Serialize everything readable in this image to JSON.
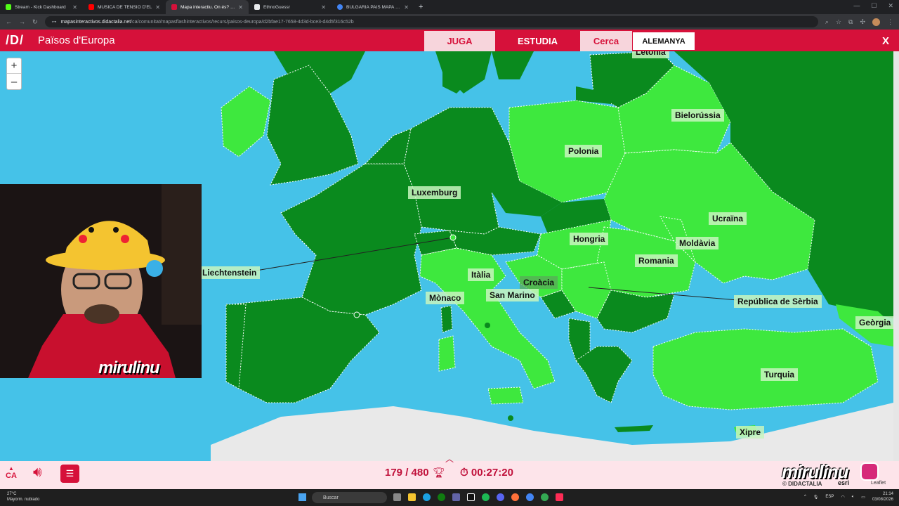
{
  "browser": {
    "tabs": [
      {
        "title": "Stream - Kick Dashboard",
        "color": "#53fc18",
        "active": false
      },
      {
        "title": "MÚSICA DE TENSIÓ D'EL",
        "color": "#ff0000",
        "active": false
      },
      {
        "title": "Mapa interactiu. On és? Països",
        "color": "#d6113a",
        "active": true
      },
      {
        "title": "EthnoGuessr",
        "color": "#e8eaed",
        "active": false
      },
      {
        "title": "BULGARIA PAIS MAPA - Cerca",
        "color": "#4285f4",
        "active": false
      }
    ],
    "url_host": "mapasinteractivos.didactalia.net",
    "url_path": "/ca/comunitat/mapasflashinteractivos/recurs/paisos-deuropa/d2bfae17-7658-4d3d-bce3-d4d5f316c52b"
  },
  "app": {
    "logo": "/D/",
    "title": "Països d'Europa",
    "modes": {
      "juga": "JUGA",
      "estudia": "ESTUDIA",
      "cerca": "Cerca"
    },
    "target_country": "ALEMANYA",
    "close": "X"
  },
  "map": {
    "zoom_in": "+",
    "zoom_out": "–",
    "labels": {
      "letonia": "Letònia",
      "bielorussia": "Bielorússia",
      "polonia": "Polonia",
      "luxemburg": "Luxemburg",
      "ucraina": "Ucraïna",
      "hongria": "Hongria",
      "moldavia": "Moldàvia",
      "romania": "Romania",
      "liechtenstein": "Liechtenstein",
      "italia": "Itàlia",
      "croacia": "Croàcia",
      "monaco": "Mònaco",
      "san_marino": "San Marino",
      "serbia": "República de Sèrbia",
      "georgia": "Geòrgia",
      "turquia": "Turquia",
      "xipre": "Xipre"
    },
    "colors": {
      "sea": "#45c2e8",
      "found": "#3ee83e",
      "dark": "#0a8a1e",
      "land": "#e9e9e9"
    }
  },
  "overlay": {
    "webcam_name": "mirulinu"
  },
  "bottom": {
    "lang": "CA",
    "score": "179 / 480",
    "timer": "00:27:20",
    "brand": "mirulinu",
    "didactalia": "© DIDACTALIA",
    "esri": "esri",
    "leaflet": "Leaflet"
  },
  "taskbar": {
    "weather_temp": "27°C",
    "weather_desc": "Mayorm. nublado",
    "search": "Buscar",
    "lang": "ESP",
    "time": "21:14",
    "date": "03/08/2026"
  }
}
